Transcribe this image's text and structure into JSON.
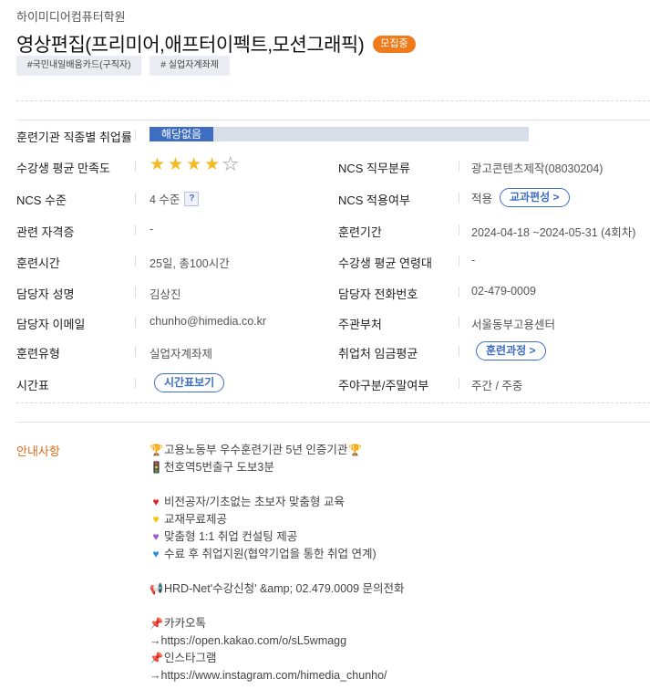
{
  "academy": "하이미디어컴퓨터학원",
  "course_title": "영상편집(프리미어,애프터이펙트,모션그래픽)",
  "status_badge": "모집중",
  "tags": [
    "#국민내일배움카드(구직자)",
    "# 실업자계좌제"
  ],
  "fields": {
    "employment_rate_label": "훈련기관 직종별 취업률",
    "employment_rate_value": "해당없음",
    "satisfaction_label": "수강생 평균 만족도",
    "satisfaction_stars": 4,
    "satisfaction_max": 5,
    "ncs_category_label": "NCS 직무분류",
    "ncs_category_value": "광고콘텐츠제작(08030204)",
    "ncs_level_label": "NCS 수준",
    "ncs_level_value": "4 수준",
    "ncs_level_help": "?",
    "ncs_apply_label": "NCS 적용여부",
    "ncs_apply_value": "적용",
    "curriculum_button": "교과편성 >",
    "cert_label": "관련 자격증",
    "cert_value": "-",
    "period_label": "훈련기간",
    "period_value": "2024-04-18 ~2024-05-31 (4회차)",
    "hours_label": "훈련시간",
    "hours_value": "25일, 총100시간",
    "age_label": "수강생 평균 연령대",
    "age_value": "-",
    "manager_label": "담당자 성명",
    "manager_value": "김상진",
    "phone_label": "담당자 전화번호",
    "phone_value": "02-479-0009",
    "email_label": "담당자 이메일",
    "email_value": "chunho@himedia.co.kr",
    "dept_label": "주관부처",
    "dept_value": "서울동부고용센터",
    "type_label": "훈련유형",
    "type_value": "실업자계좌제",
    "wage_label": "취업처 임금평균",
    "wage_button": "훈련과정 >",
    "schedule_label": "시간표",
    "schedule_button": "시간표보기",
    "daynight_label": "주야구분/주말여부",
    "daynight_value": "주간 / 주중"
  },
  "notice": {
    "label": "안내사항",
    "lines": [
      {
        "icon": "trophy-icon",
        "text": "고용노동부 우수훈련기관 5년 인증기관"
      },
      {
        "icon": "traffic-light-icon",
        "text": "천호역5번출구 도보3분"
      },
      {
        "icon": "",
        "text": ""
      },
      {
        "icon": "red-heart-icon",
        "text": "비전공자/기초없는 초보자 맞춤형 교육"
      },
      {
        "icon": "yellow-heart-icon",
        "text": "교재무료제공"
      },
      {
        "icon": "purple-heart-icon",
        "text": "맞춤형 1:1 취업 컨설팅 제공"
      },
      {
        "icon": "blue-heart-icon",
        "text": "수료 후 취업지원(협약기업을 통한 취업 연계)"
      },
      {
        "icon": "",
        "text": ""
      },
      {
        "icon": "megaphone-icon",
        "text": "HRD-Net'수강신청' &amp; 02.479.0009 문의전화"
      },
      {
        "icon": "",
        "text": ""
      },
      {
        "icon": "pushpin-icon",
        "text": "카카오톡"
      },
      {
        "icon": "",
        "text": "→https://open.kakao.com/o/sL5wmagg"
      },
      {
        "icon": "pushpin-icon",
        "text": "인스타그램"
      },
      {
        "icon": "",
        "text": "→https://www.instagram.com/himedia_chunho/"
      }
    ]
  },
  "colors": {
    "accent_blue": "#3e6dc2",
    "badge_orange": "#f07b1a",
    "notice_orange": "#e06a16",
    "star_gold": "#f5b921"
  }
}
